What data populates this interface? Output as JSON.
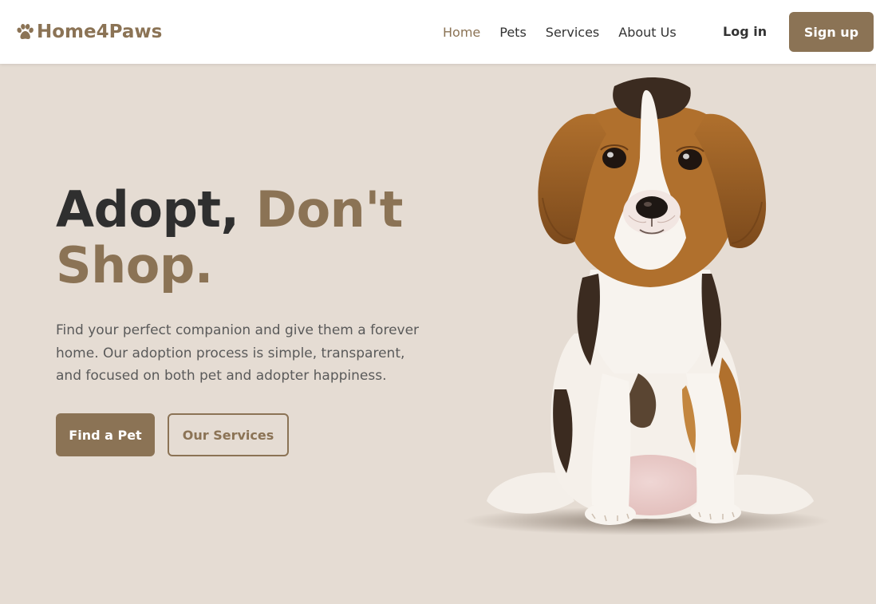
{
  "header": {
    "logo_text": "Home4Paws",
    "logo_icon": "paw-icon",
    "nav": [
      {
        "label": "Home",
        "active": true
      },
      {
        "label": "Pets",
        "active": false
      },
      {
        "label": "Services",
        "active": false
      },
      {
        "label": "About Us",
        "active": false
      }
    ],
    "login_label": "Log in",
    "signup_label": "Sign up"
  },
  "hero": {
    "headline_part1": "Adopt, ",
    "headline_part2": "Don't Shop.",
    "description": "Find your perfect companion and give them a forever home. Our adoption process is simple, transparent, and focused on both pet and adopter happiness.",
    "primary_button": "Find a Pet",
    "secondary_button": "Our Services",
    "image": "beagle-puppy-photo"
  },
  "colors": {
    "brand": "#8b7355",
    "hero_background": "#e5dcd3",
    "text_dark": "#2f2f2f",
    "text_body": "#5a5a5a",
    "header_background": "#ffffff"
  }
}
